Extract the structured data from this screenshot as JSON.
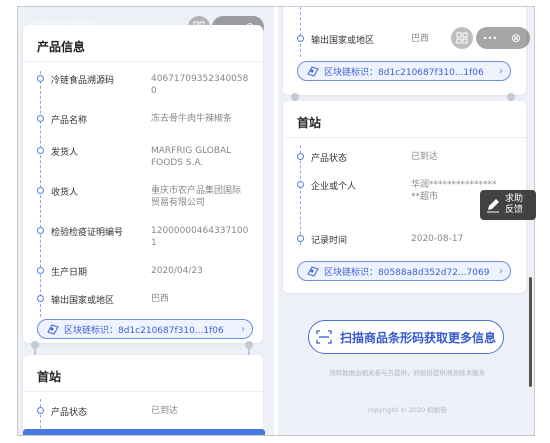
{
  "left_panel": {
    "header_faded": "冷链食品溯源",
    "product_card": {
      "title": "产品信息",
      "rows": [
        {
          "label": "冷链食品溯源码",
          "value": "406717093523400580"
        },
        {
          "label": "产品名称",
          "value": "冻去骨牛肉牛辣椒条"
        },
        {
          "label": "发货人",
          "value": "MARFRIG GLOBAL FOODS S.A."
        },
        {
          "label": "收货人",
          "value": "重庆市农产品集团国际贸易有限公司"
        },
        {
          "label": "检验检疫证明编号",
          "value": "120000004643371001"
        },
        {
          "label": "生产日期",
          "value": "2020/04/23"
        },
        {
          "label": "输出国家或地区",
          "value": "巴西"
        }
      ],
      "chain_label": "区块链标识：8d1c210687f310...1f06"
    },
    "first_station_card": {
      "title": "首站",
      "rows": [
        {
          "label": "产品状态",
          "value": "已到达"
        }
      ]
    }
  },
  "right_panel": {
    "top_row": {
      "label": "输出国家或地区",
      "value": "巴西"
    },
    "top_chain_label": "区块链标识：8d1c210687f310...1f06",
    "first_station_card": {
      "title": "首站",
      "rows": [
        {
          "label": "产品状态",
          "value": "已到达"
        },
        {
          "label": "企业或个人",
          "value": "华润*****************超市"
        },
        {
          "label": "记录时间",
          "value": "2020-08-17"
        }
      ],
      "chain_label": "区块链标识：80588a8d352d72...7069"
    },
    "scan_button_label": "扫描商品条形码获取更多信息",
    "footer_note": "流转数据由相关参与方提供，蚂蚁链提供溯源技术服务",
    "copyright": "copyright © 2020 蚂蚁链"
  },
  "feedback": {
    "line1": "求助",
    "line2": "反馈"
  },
  "capsule": {
    "more": "•••",
    "close": "⊗"
  },
  "icons": [
    "scan-icon",
    "more-icon",
    "close-icon",
    "blockchain-icon",
    "chevron-right-icon",
    "edit-icon",
    "barcode-icon"
  ],
  "colors": {
    "accent": "#3d63d6",
    "panel_bg": "#eef0f7",
    "timeline": "#5a7ee0"
  }
}
